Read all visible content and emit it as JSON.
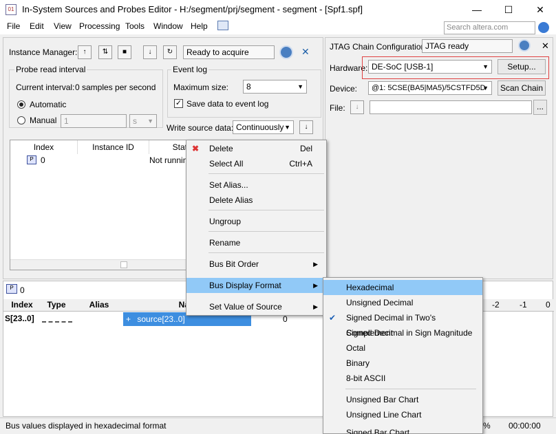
{
  "window": {
    "title": "In-System Sources and Probes Editor - H:/segment/prj/segment - segment - [Spf1.spf]",
    "minimize": "—",
    "maximize": "☐",
    "close": "✕"
  },
  "menubar": {
    "items": [
      "File",
      "Edit",
      "View",
      "Processing",
      "Tools",
      "Window",
      "Help"
    ],
    "search_placeholder": "Search altera.com"
  },
  "instance_manager": {
    "label": "Instance Manager:",
    "status": "Ready to acquire",
    "probe_read_interval": {
      "title": "Probe read interval",
      "current_label": "Current interval:",
      "current_value": "0 samples per second",
      "automatic": "Automatic",
      "manual": "Manual",
      "manual_value": "1",
      "unit": "s"
    },
    "event_log": {
      "title": "Event log",
      "max_size_label": "Maximum size:",
      "max_size_value": "8",
      "save_label": "Save data to event log",
      "save_checked": true
    },
    "write_source_label": "Write source data:",
    "write_source_value": "Continuously",
    "table": {
      "headers": [
        "Index",
        "Instance ID",
        "Stat"
      ],
      "rows": [
        {
          "index": "0",
          "status": "Not running"
        }
      ]
    }
  },
  "jtag": {
    "label": "JTAG Chain Configuration:",
    "status": "JTAG ready",
    "hardware_label": "Hardware:",
    "hardware_value": "DE-SoC [USB-1]",
    "setup_label": "Setup...",
    "device_label": "Device:",
    "device_value": "@1: 5CSE(BA5|MA5)/5CSTFD5D",
    "scan_label": "Scan Chain",
    "file_label": "File:",
    "browse_label": "..."
  },
  "bottom": {
    "tab_label": "0",
    "headers": [
      "Index",
      "Type",
      "Alias",
      "Na"
    ],
    "row": {
      "index": "S[23..0]",
      "name": "source[23..0]",
      "value": "0"
    },
    "scale": [
      "-2",
      "-1",
      "0"
    ],
    "expand": "+"
  },
  "status": {
    "message": "Bus values displayed in hexadecimal format",
    "percent": "%",
    "time": "00:00:00"
  },
  "context_menu": {
    "items": [
      {
        "label": "Delete",
        "shortcut": "Del"
      },
      {
        "label": "Select All",
        "shortcut": "Ctrl+A"
      },
      {
        "label": "Set Alias..."
      },
      {
        "label": "Delete Alias"
      },
      {
        "label": "Ungroup"
      },
      {
        "label": "Rename"
      },
      {
        "label": "Bus Bit Order"
      },
      {
        "label": "Bus Display Format"
      },
      {
        "label": "Set Value of Source"
      }
    ]
  },
  "submenu": {
    "items": [
      "Hexadecimal",
      "Unsigned Decimal",
      "Signed Decimal in Two's Complement",
      "Signed Decimal in Sign Magnitude",
      "Octal",
      "Binary",
      "8-bit ASCII",
      "Unsigned Bar Chart",
      "Unsigned Line Chart",
      "Signed Bar Chart"
    ],
    "checked": "Signed Decimal in Two's Complement"
  }
}
